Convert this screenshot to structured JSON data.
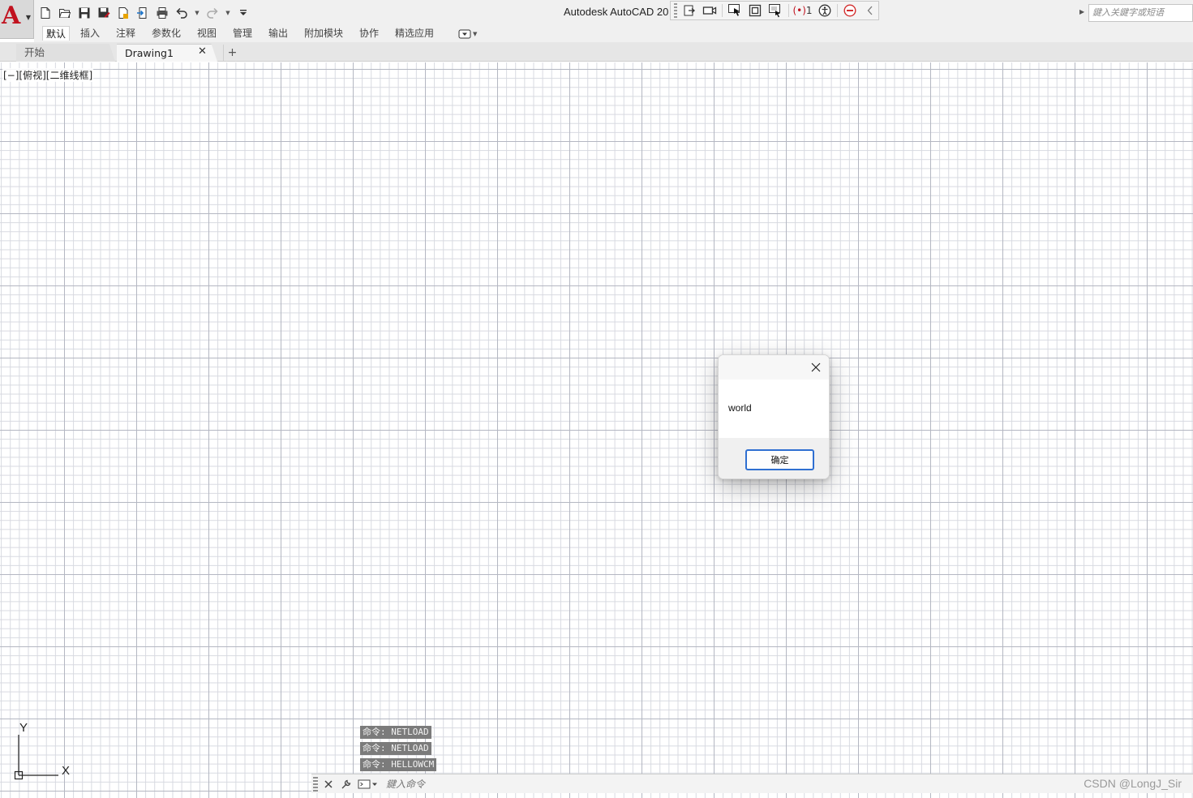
{
  "app": {
    "logo_letter": "A",
    "title": "Autodesk AutoCAD 20",
    "brand_color": "#c1121f"
  },
  "quick_access": [
    "new-icon",
    "open-icon",
    "save-icon",
    "save-as-icon",
    "plot-preview-icon",
    "share-icon",
    "print-icon",
    "undo-icon",
    "redo-icon",
    "customize-icon"
  ],
  "float_toolbar": {
    "count_label": "1"
  },
  "search": {
    "placeholder": "鍵入关鍵字或短语"
  },
  "ribbon": {
    "tabs": [
      "默认",
      "插入",
      "注释",
      "参数化",
      "视图",
      "管理",
      "输出",
      "附加模块",
      "协作",
      "精选应用"
    ],
    "active_index": 0
  },
  "file_tabs": {
    "start_label": "开始",
    "drawing_label": "Drawing1"
  },
  "viewport": {
    "label": "[−][俯视][二维线框]"
  },
  "ucs": {
    "x_label": "X",
    "y_label": "Y"
  },
  "command_history": [
    "命令: NETLOAD",
    "命令: NETLOAD",
    "命令: HELLOWCM"
  ],
  "command_line": {
    "placeholder": "鍵入命令"
  },
  "watermark": "CSDN @LongJ_Sir",
  "dialog": {
    "message": "world",
    "ok_label": "确定"
  }
}
